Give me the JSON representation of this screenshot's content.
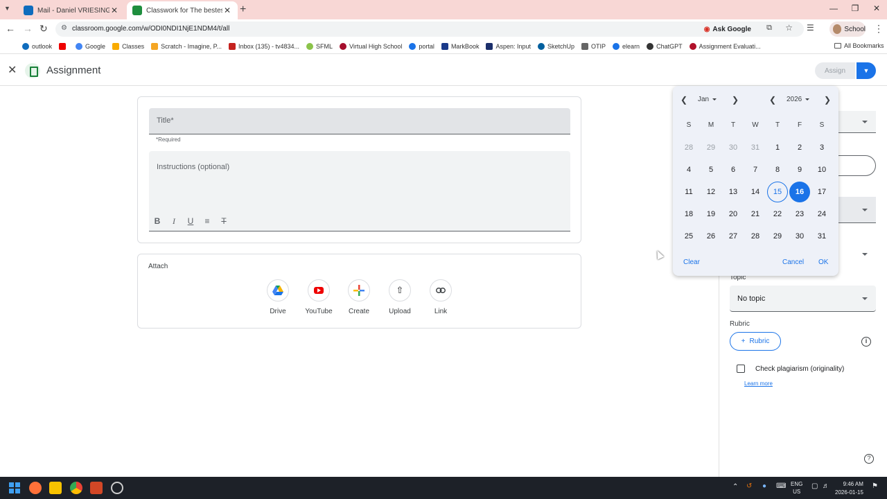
{
  "browser": {
    "tabs": [
      {
        "title": "Mail - Daniel VRIESINGA - Outl",
        "active": false
      },
      {
        "title": "Classwork for The bestest class",
        "active": true
      }
    ],
    "url": "classroom.google.com/w/ODI0NDI1NjE1NDM4/t/all",
    "ask_google": "Ask Google",
    "profile": "School",
    "bookmarks": [
      "outlook",
      "Google",
      "Classes",
      "Scratch - Imagine, P...",
      "Inbox (135) - tv4834...",
      "SFML",
      "Virtual High School",
      "portal",
      "MarkBook",
      "Aspen: Input",
      "SketchUp",
      "OTIP",
      "elearn",
      "ChatGPT",
      "Assignment Evaluati..."
    ],
    "all_bookmarks": "All Bookmarks"
  },
  "header": {
    "title": "Assignment",
    "assign_label": "Assign"
  },
  "form": {
    "title_placeholder": "Title*",
    "required_note": "*Required",
    "instructions_placeholder": "Instructions (optional)",
    "attach_label": "Attach",
    "attach_options": [
      {
        "label": "Drive",
        "icon": "drive-icon"
      },
      {
        "label": "YouTube",
        "icon": "youtube-icon"
      },
      {
        "label": "Create",
        "icon": "plus-icon"
      },
      {
        "label": "Upload",
        "icon": "upload-icon"
      },
      {
        "label": "Link",
        "icon": "link-icon"
      }
    ]
  },
  "sidebar": {
    "topic_label": "Topic",
    "topic_value": "No topic",
    "rubric_label": "Rubric",
    "rubric_button": "Rubric",
    "plagiarism_label": "Check plagiarism (originality)",
    "plagiarism_checked": false,
    "learn_more": "Learn more"
  },
  "datepicker": {
    "month": "Jan",
    "year": "2026",
    "weekdays": [
      "S",
      "M",
      "T",
      "W",
      "T",
      "F",
      "S"
    ],
    "weeks": [
      [
        "28",
        "29",
        "30",
        "31",
        "1",
        "2",
        "3"
      ],
      [
        "4",
        "5",
        "6",
        "7",
        "8",
        "9",
        "10"
      ],
      [
        "11",
        "12",
        "13",
        "14",
        "15",
        "16",
        "17"
      ],
      [
        "18",
        "19",
        "20",
        "21",
        "22",
        "23",
        "24"
      ],
      [
        "25",
        "26",
        "27",
        "28",
        "29",
        "30",
        "31"
      ]
    ],
    "today": "15",
    "selected": "16",
    "clear": "Clear",
    "cancel": "Cancel",
    "ok": "OK"
  },
  "taskbar": {
    "lang": "ENG",
    "region": "US",
    "time": "9:46 AM",
    "date": "2026-01-15"
  },
  "colors": {
    "accent": "#1a73e8",
    "tabstrip": "#f8d7d5",
    "taskbar": "#1d2128"
  }
}
